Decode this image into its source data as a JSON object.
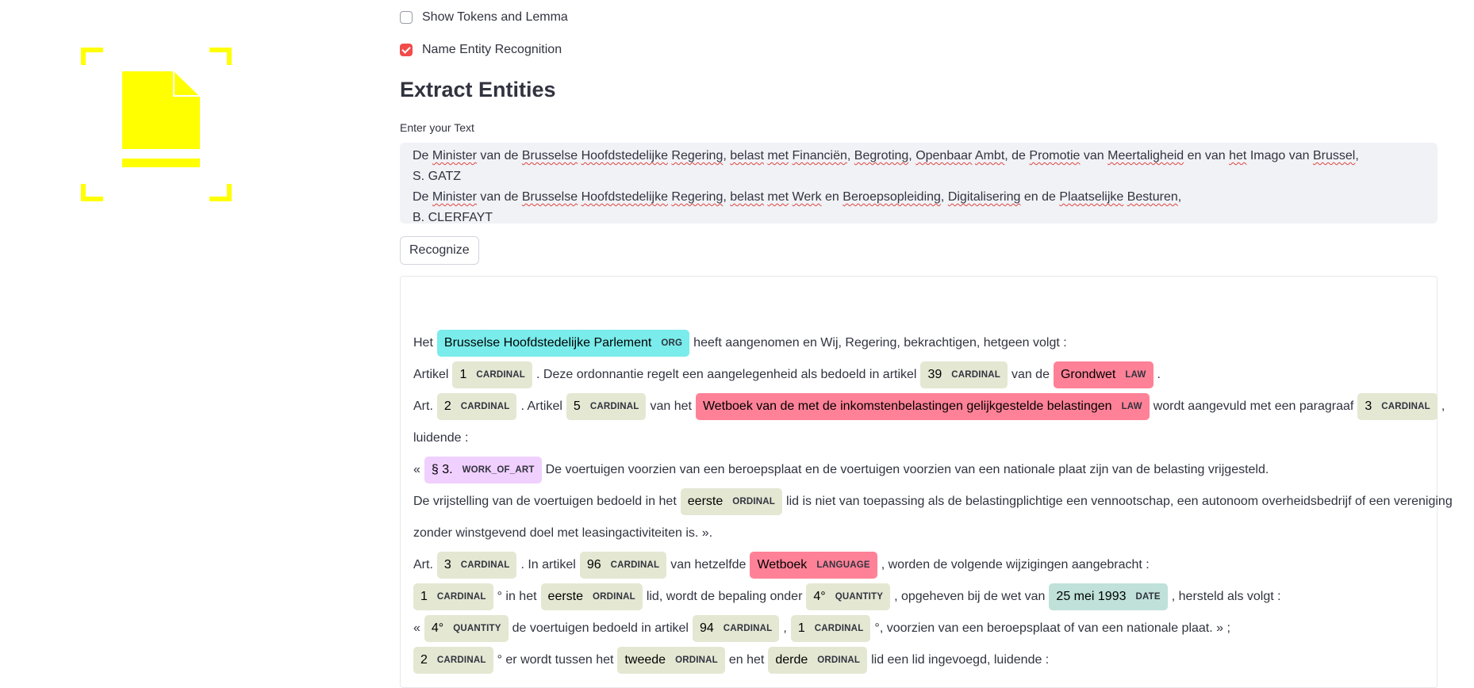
{
  "sidebar": {
    "logo_icon": "document-scan-icon",
    "logo_color": "#ffff00"
  },
  "options": {
    "show_tokens": {
      "label": "Show Tokens and Lemma",
      "checked": false
    },
    "ner": {
      "label": "Name Entity Recognition",
      "checked": true
    }
  },
  "section_title": "Extract Entities",
  "input": {
    "label": "Enter your Text",
    "line1": [
      {
        "t": "De "
      },
      {
        "t": "Minister",
        "sq": true
      },
      {
        "t": " van de "
      },
      {
        "t": "Brusselse",
        "sq": true
      },
      {
        "t": " "
      },
      {
        "t": "Hoofdstedelijke",
        "sq": true
      },
      {
        "t": " "
      },
      {
        "t": "Regering",
        "sq": true
      },
      {
        "t": ", "
      },
      {
        "t": "belast",
        "sq": true
      },
      {
        "t": " "
      },
      {
        "t": "met",
        "sq": true
      },
      {
        "t": " "
      },
      {
        "t": "Financiën",
        "sq": true
      },
      {
        "t": ", "
      },
      {
        "t": "Begroting",
        "sq": true
      },
      {
        "t": ", "
      },
      {
        "t": "Openbaar",
        "sq": true
      },
      {
        "t": " "
      },
      {
        "t": "Ambt",
        "sq": true
      },
      {
        "t": ", de "
      },
      {
        "t": "Promotie",
        "sq": true
      },
      {
        "t": " van "
      },
      {
        "t": "Meertaligheid",
        "sq": true
      },
      {
        "t": " en van "
      },
      {
        "t": "het",
        "sq": true
      },
      {
        "t": " Imago van "
      },
      {
        "t": "Brussel",
        "sq": true
      },
      {
        "t": ","
      }
    ],
    "line2": "S. GATZ",
    "line3": [
      {
        "t": "De "
      },
      {
        "t": "Minister",
        "sq": true
      },
      {
        "t": " van de "
      },
      {
        "t": "Brusselse",
        "sq": true
      },
      {
        "t": " "
      },
      {
        "t": "Hoofdstedelijke",
        "sq": true
      },
      {
        "t": " "
      },
      {
        "t": "Regering",
        "sq": true
      },
      {
        "t": ", "
      },
      {
        "t": "belast",
        "sq": true
      },
      {
        "t": " "
      },
      {
        "t": "met",
        "sq": true
      },
      {
        "t": " "
      },
      {
        "t": "Werk",
        "sq": true
      },
      {
        "t": " en "
      },
      {
        "t": "Beroepsopleiding",
        "sq": true
      },
      {
        "t": ", "
      },
      {
        "t": "Digitalisering",
        "sq": true
      },
      {
        "t": " en de "
      },
      {
        "t": "Plaatselijke",
        "sq": true
      },
      {
        "t": " "
      },
      {
        "t": "Besturen",
        "sq": true
      },
      {
        "t": ","
      }
    ],
    "line4": "B. CLERFAYT"
  },
  "recognize_button": "Recognize",
  "result_lines": [
    [
      {
        "t": "Het"
      },
      {
        "e": "Brusselse Hoofdstedelijke Parlement",
        "l": "ORG"
      },
      {
        "t": "heeft aangenomen en Wij, Regering, bekrachtigen, hetgeen volgt :"
      }
    ],
    [
      {
        "t": "Artikel"
      },
      {
        "e": "1",
        "l": "CARDINAL"
      },
      {
        "t": ". Deze ordonnantie regelt een aangelegenheid als bedoeld in artikel"
      },
      {
        "e": "39",
        "l": "CARDINAL"
      },
      {
        "t": "van de"
      },
      {
        "e": "Grondwet",
        "l": "LAW"
      },
      {
        "t": "."
      }
    ],
    [
      {
        "t": "Art."
      },
      {
        "e": "2",
        "l": "CARDINAL"
      },
      {
        "t": ". Artikel"
      },
      {
        "e": "5",
        "l": "CARDINAL"
      },
      {
        "t": "van het"
      },
      {
        "e": "Wetboek van de met de inkomstenbelastingen gelijkgestelde belastingen",
        "l": "LAW"
      },
      {
        "t": "wordt aangevuld met een paragraaf"
      },
      {
        "e": "3",
        "l": "CARDINAL"
      },
      {
        "t": ","
      }
    ],
    [
      {
        "t": "luidende :"
      }
    ],
    [
      {
        "t": "«"
      },
      {
        "e": "§ 3.",
        "l": "WORK_OF_ART"
      },
      {
        "t": "De voertuigen voorzien van een beroepsplaat en de voertuigen voorzien van een nationale plaat zijn van de belasting vrijgesteld."
      }
    ],
    [
      {
        "t": "De vrijstelling van de voertuigen bedoeld in het"
      },
      {
        "e": "eerste",
        "l": "ORDINAL"
      },
      {
        "t": "lid is niet van toepassing als de belastingplichtige een vennootschap, een autonoom overheidsbedrijf of een vereniging"
      }
    ],
    [
      {
        "t": "zonder winstgevend doel met leasingactiviteiten is. »."
      }
    ],
    [
      {
        "t": "Art."
      },
      {
        "e": "3",
        "l": "CARDINAL"
      },
      {
        "t": ". In artikel"
      },
      {
        "e": "96",
        "l": "CARDINAL"
      },
      {
        "t": "van hetzelfde"
      },
      {
        "e": "Wetboek",
        "l": "LANGUAGE"
      },
      {
        "t": ", worden de volgende wijzigingen aangebracht :"
      }
    ],
    [
      {
        "e": "1",
        "l": "CARDINAL"
      },
      {
        "t": "° in het"
      },
      {
        "e": "eerste",
        "l": "ORDINAL"
      },
      {
        "t": "lid, wordt de bepaling onder"
      },
      {
        "e": "4°",
        "l": "QUANTITY"
      },
      {
        "t": ", opgeheven bij de wet van"
      },
      {
        "e": "25 mei 1993",
        "l": "DATE"
      },
      {
        "t": ", hersteld als volgt :"
      }
    ],
    [
      {
        "t": "«"
      },
      {
        "e": "4°",
        "l": "QUANTITY"
      },
      {
        "t": "de voertuigen bedoeld in artikel"
      },
      {
        "e": "94",
        "l": "CARDINAL"
      },
      {
        "t": ","
      },
      {
        "e": "1",
        "l": "CARDINAL"
      },
      {
        "t": "°, voorzien van een beroepsplaat of van een nationale plaat. » ;"
      }
    ],
    [
      {
        "e": "2",
        "l": "CARDINAL"
      },
      {
        "t": "° er wordt tussen het"
      },
      {
        "e": "tweede",
        "l": "ORDINAL"
      },
      {
        "t": "en het"
      },
      {
        "e": "derde",
        "l": "ORDINAL"
      },
      {
        "t": "lid een lid ingevoegd, luidende :"
      }
    ]
  ],
  "entity_colors": {
    "CARDINAL": "#e4e7d2",
    "ORDINAL": "#e4e7d2",
    "QUANTITY": "#e4e7d2",
    "ORG": "#7aecec",
    "LAW": "#ff8197",
    "LANGUAGE": "#ff8197",
    "WORK_OF_ART": "#f0d0ff",
    "DATE": "#bfe1d9"
  }
}
